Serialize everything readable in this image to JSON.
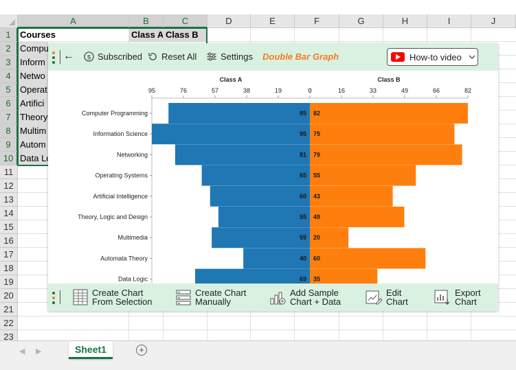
{
  "spreadsheet": {
    "columns": [
      "A",
      "B",
      "C",
      "D",
      "E",
      "F",
      "G",
      "H",
      "I",
      "J"
    ],
    "rows": [
      "1",
      "2",
      "3",
      "4",
      "5",
      "6",
      "7",
      "8",
      "9",
      "10",
      "11",
      "12",
      "13",
      "14",
      "15",
      "16",
      "17",
      "18",
      "19",
      "20",
      "21",
      "22",
      "23"
    ],
    "header_row": [
      "Courses",
      "Class A",
      "Class B"
    ],
    "visible_cells_a": [
      "Compu",
      "Inform",
      "Netwo",
      "Operat",
      "Artifici",
      "Theory",
      "Multim",
      "Autom",
      "Data Lo"
    ]
  },
  "sheet_tabs": {
    "active": "Sheet1",
    "add_label": "+"
  },
  "toolbar": {
    "back": "←",
    "subscribed": "Subscribed",
    "reset": "Reset All",
    "settings": "Settings",
    "brand": "Double Bar Graph",
    "howto": "How-to video"
  },
  "bottom_toolbar": {
    "create_selection": [
      "Create Chart",
      "From Selection"
    ],
    "create_manual": [
      "Create Chart",
      "Manually"
    ],
    "add_sample": [
      "Add Sample",
      "Chart + Data"
    ],
    "edit": [
      "Edit",
      "Chart"
    ],
    "export": [
      "Export",
      "Chart"
    ]
  },
  "colors": {
    "class_a": "#1f77b4",
    "class_b": "#ff7f0e",
    "accent_green": "#1e7145",
    "panel_bar": "#d9f1e1",
    "brand_orange": "#f47c20"
  },
  "chart_data": {
    "type": "bar",
    "orientation": "horizontal-butterfly",
    "categories": [
      "Computer Programming",
      "Information Science",
      "Networking",
      "Operating Systems",
      "Artificial Intelligence",
      "Theory, Logic and Design",
      "Multimedia",
      "Automata Theory",
      "Data Logic"
    ],
    "series": [
      {
        "name": "Class A",
        "values": [
          85,
          95,
          81,
          65,
          60,
          55,
          59,
          40,
          69
        ]
      },
      {
        "name": "Class B",
        "values": [
          82,
          75,
          79,
          55,
          43,
          49,
          20,
          60,
          35
        ]
      }
    ],
    "left_ticks": [
      "95",
      "76",
      "57",
      "38",
      "19",
      "0"
    ],
    "right_ticks": [
      "0",
      "16",
      "33",
      "49",
      "66",
      "82"
    ],
    "left_max": 95,
    "right_max": 82,
    "grid": false,
    "legend": "none"
  }
}
